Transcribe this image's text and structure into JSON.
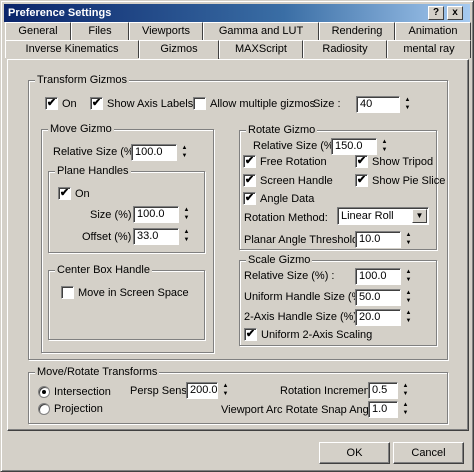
{
  "window": {
    "title": "Preference Settings",
    "help_label": "?",
    "close_label": "x"
  },
  "tabs_row1": [
    "General",
    "Files",
    "Viewports",
    "Gamma and LUT",
    "Rendering",
    "Animation"
  ],
  "tabs_row2": [
    "Inverse Kinematics",
    "Gizmos",
    "MAXScript",
    "Radiosity",
    "mental ray"
  ],
  "active_tab": "Gizmos",
  "transform_gizmos": {
    "title": "Transform Gizmos",
    "on_label": "On",
    "on_checked": "✔",
    "show_axis_labels": "Show Axis Labels",
    "show_axis_checked": "✔",
    "allow_multiple": "Allow multiple gizmos",
    "allow_multiple_checked": "",
    "size_label": "Size :",
    "size_value": "40"
  },
  "move_gizmo": {
    "title": "Move Gizmo",
    "relative_size_label": "Relative Size (%) :",
    "relative_size_value": "100.0",
    "plane_handles": {
      "title": "Plane Handles",
      "on_label": "On",
      "on_checked": "✔",
      "size_label": "Size (%) :",
      "size_value": "100.0",
      "offset_label": "Offset (%) :",
      "offset_value": "33.0"
    },
    "center_box": {
      "title": "Center Box Handle",
      "move_screen_label": "Move in Screen Space",
      "move_screen_checked": ""
    }
  },
  "rotate_gizmo": {
    "title": "Rotate Gizmo",
    "relative_size_label": "Relative Size (%) :",
    "relative_size_value": "150.0",
    "free_rotation": "Free Rotation",
    "free_rotation_checked": "✔",
    "show_tripod": "Show Tripod",
    "show_tripod_checked": "✔",
    "screen_handle": "Screen Handle",
    "screen_handle_checked": "✔",
    "show_pie_slice": "Show Pie Slice",
    "show_pie_slice_checked": "✔",
    "angle_data": "Angle Data",
    "angle_data_checked": "✔",
    "rotation_method_label": "Rotation Method:",
    "rotation_method_value": "Linear Roll",
    "planar_angle_label": "Planar Angle Threshold :",
    "planar_angle_value": "10.0"
  },
  "scale_gizmo": {
    "title": "Scale Gizmo",
    "relative_size_label": "Relative Size (%) :",
    "relative_size_value": "100.0",
    "uniform_handle_label": "Uniform Handle Size (%) :",
    "uniform_handle_value": "50.0",
    "two_axis_label": "2-Axis Handle Size (%) :",
    "two_axis_value": "20.0",
    "uniform_scaling_label": "Uniform 2-Axis Scaling",
    "uniform_scaling_checked": "✔"
  },
  "move_rotate": {
    "title": "Move/Rotate Transforms",
    "intersection_label": "Intersection",
    "projection_label": "Projection",
    "persp_sens_label": "Persp Sens:",
    "persp_sens_value": "200.0",
    "rotation_increment_label": "Rotation Increment:",
    "rotation_increment_value": "0.5",
    "arc_snap_label": "Viewport Arc Rotate Snap Angle:",
    "arc_snap_value": "1.0"
  },
  "buttons": {
    "ok": "OK",
    "cancel": "Cancel"
  }
}
